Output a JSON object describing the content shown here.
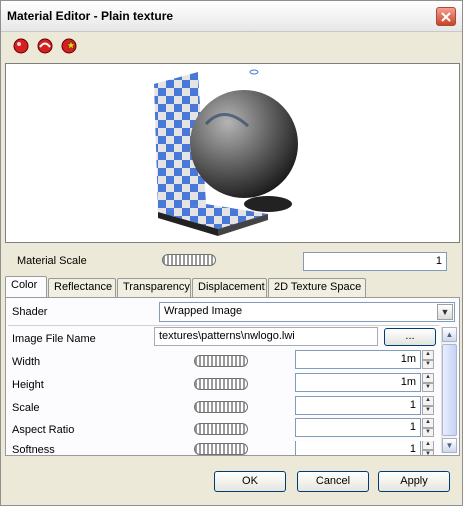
{
  "window": {
    "title": "Material Editor - Plain texture"
  },
  "toolbar": {
    "buttons": [
      {
        "icon": "red-sphere-icon"
      },
      {
        "icon": "sphere-arrow-icon"
      },
      {
        "icon": "sphere-star-icon"
      }
    ]
  },
  "material_scale": {
    "label": "Material Scale",
    "value": "1"
  },
  "tabs": [
    "Color",
    "Reflectance",
    "Transparency",
    "Displacement",
    "2D Texture Space"
  ],
  "active_tab": "Color",
  "shader": {
    "label": "Shader",
    "value": "Wrapped Image"
  },
  "image_file": {
    "label": "Image File Name",
    "value": "textures\\patterns\\nwlogo.lwi",
    "browse_label": "..."
  },
  "params": [
    {
      "label": "Width",
      "value": "1m"
    },
    {
      "label": "Height",
      "value": "1m"
    },
    {
      "label": "Scale",
      "value": "1"
    },
    {
      "label": "Aspect Ratio",
      "value": "1"
    },
    {
      "label": "Softness",
      "value": "1"
    }
  ],
  "buttons": {
    "ok": "OK",
    "cancel": "Cancel",
    "apply": "Apply"
  },
  "colors": {
    "accent": "#4a78d8",
    "window_bg": "#ece9d8"
  }
}
